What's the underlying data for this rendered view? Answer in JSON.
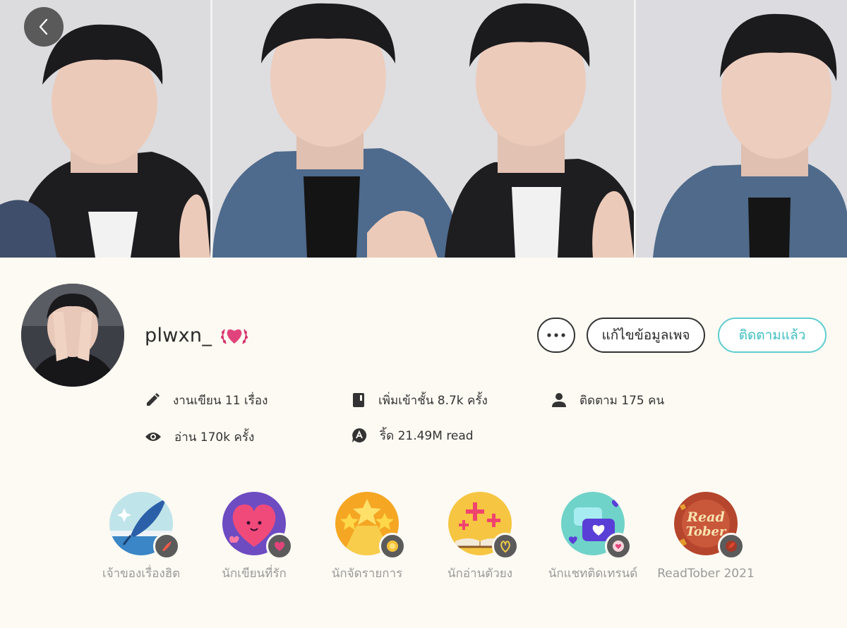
{
  "navigation": {
    "back_icon": "chevron-left-icon"
  },
  "profile": {
    "username": "plwxn_",
    "badge_icon": "heart-laurel-icon"
  },
  "actions": {
    "more_icon": "more-horizontal-icon",
    "edit_label": "แก้ไขข้อมูลเพจ",
    "follow_label": "ติดตามแล้ว"
  },
  "stats": [
    {
      "icon": "pencil-icon",
      "text": "งานเขียน 11 เรื่อง"
    },
    {
      "icon": "book-icon",
      "text": "เพิ่มเข้าชั้น 8.7k ครั้ง"
    },
    {
      "icon": "person-icon",
      "text": "ติดตาม 175 คน"
    },
    {
      "icon": "eye-icon",
      "text": "อ่าน 170k ครั้ง"
    },
    {
      "icon": "chat-a-icon",
      "text": "ริ้ด 21.49M read"
    }
  ],
  "achievements": [
    {
      "label": "เจ้าของเรื่องฮิต",
      "icon": "quill-icon"
    },
    {
      "label": "นักเขียนที่รัก",
      "icon": "heart-icon"
    },
    {
      "label": "นักจัดรายการ",
      "icon": "star-icon"
    },
    {
      "label": "นักอ่านตัวยง",
      "icon": "open-book-icon"
    },
    {
      "label": "นักแชทติดเทรนด์",
      "icon": "chat-heart-icon"
    },
    {
      "label": "ReadTober 2021",
      "icon": "readtober-icon"
    }
  ],
  "colors": {
    "background": "#fdfaf3",
    "accent": "#3fbfc2",
    "text": "#2b2b2b",
    "muted": "#9a9a9a"
  }
}
